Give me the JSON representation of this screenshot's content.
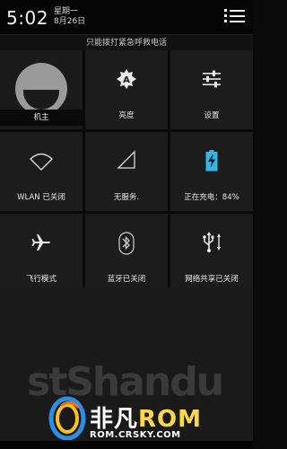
{
  "status": {
    "time": "5:02",
    "weekday": "星期一",
    "date": "8月26日"
  },
  "emergency_text": "只能拨打紧急呼救电话",
  "tiles": [
    {
      "label": "机主",
      "icon": "user-avatar-icon"
    },
    {
      "label": "亮度",
      "icon": "brightness-auto-icon"
    },
    {
      "label": "设置",
      "icon": "settings-sliders-icon"
    },
    {
      "label": "WLAN 已关闭",
      "icon": "wifi-icon"
    },
    {
      "label": "无服务.",
      "icon": "signal-icon"
    },
    {
      "label": "正在充电：84%",
      "icon": "battery-charging-icon"
    },
    {
      "label": "飞行模式",
      "icon": "airplane-icon"
    },
    {
      "label": "蓝牙已关闭",
      "icon": "bluetooth-icon"
    },
    {
      "label": "网络共享已关闭",
      "icon": "usb-tethering-icon"
    }
  ],
  "watermark": {
    "brand_prefix": "非凡",
    "brand_rom": "ROM",
    "url": "ROM.CRSKY.COM",
    "faded_text": "stShandu"
  },
  "colors": {
    "background": "#0a0a0a",
    "tile": "#1c1c1c",
    "battery_accent": "#33b5e5",
    "watermark_gold": "#ffd84a"
  }
}
